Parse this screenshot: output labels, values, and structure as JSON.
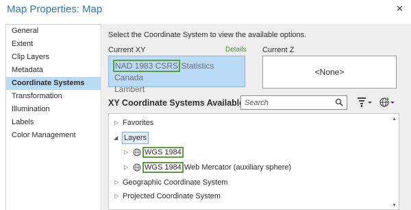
{
  "dialog": {
    "title": "Map Properties: Map",
    "close_glyph": "✕"
  },
  "sidebar": {
    "items": [
      {
        "label": "General",
        "active": false
      },
      {
        "label": "Extent",
        "active": false
      },
      {
        "label": "Clip Layers",
        "active": false
      },
      {
        "label": "Metadata",
        "active": false
      },
      {
        "label": "Coordinate Systems",
        "active": true
      },
      {
        "label": "Transformation",
        "active": false
      },
      {
        "label": "Illumination",
        "active": false
      },
      {
        "label": "Labels",
        "active": false
      },
      {
        "label": "Color Management",
        "active": false
      }
    ]
  },
  "main": {
    "instruction": "Select the Coordinate System to view the available options.",
    "current_xy_label": "Current XY",
    "details_link": "Details",
    "current_z_label": "Current Z",
    "current_xy": {
      "highlight": "NAD 1983 CSRS",
      "rest_line1": " Statistics Canada",
      "line2": "Lambert"
    },
    "current_z": "<None>",
    "available_heading": "XY Coordinate Systems Available",
    "search": {
      "placeholder": "Search",
      "value": ""
    },
    "icons": {
      "search": "search-icon",
      "filter": "filter-icon",
      "globe_menu": "globe-add-icon"
    },
    "tree": {
      "favorites": "Favorites",
      "layers": "Layers",
      "layer_items": [
        {
          "highlight": "WGS 1984",
          "rest": ""
        },
        {
          "highlight": "WGS 1984",
          "rest": " Web Mercator (auxiliary sphere)"
        }
      ],
      "geographic": "Geographic Coordinate System",
      "projected": "Projected Coordinate System"
    }
  },
  "colors": {
    "accent_title": "#2a7ab5",
    "selection": "#b9dbf6",
    "highlight_outline": "#5a9d3a",
    "details_link": "#3b8c3b"
  }
}
